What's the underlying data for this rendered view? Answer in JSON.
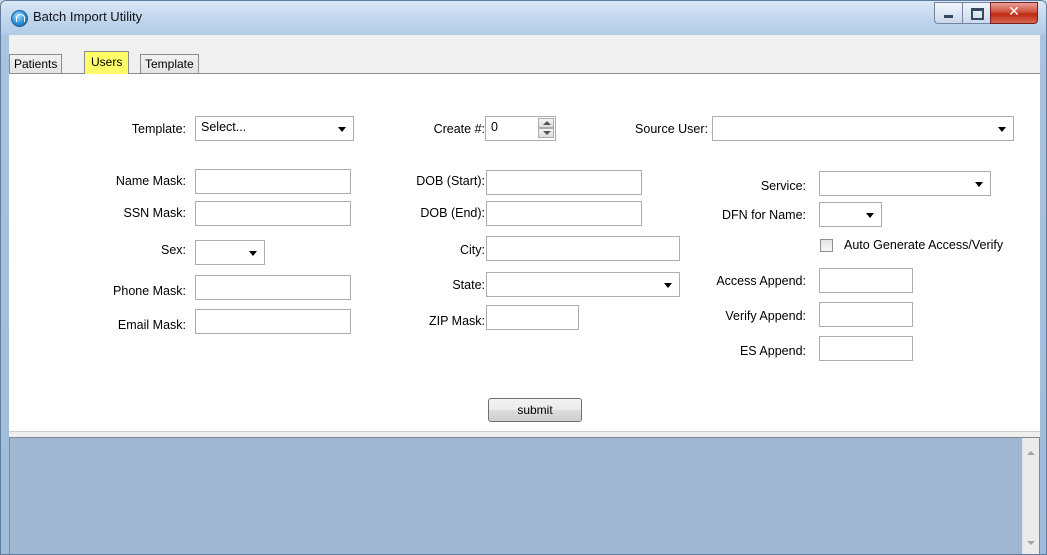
{
  "window": {
    "title": "Batch Import Utility",
    "buttons": {
      "minimize": "minimize",
      "maximize": "maximize",
      "close": "x"
    }
  },
  "tabs": [
    {
      "label": "Patients",
      "active": false
    },
    {
      "label": "Users",
      "active": true
    },
    {
      "label": "Template",
      "active": false
    }
  ],
  "colors": {
    "active_tab": "#ffff66",
    "output_panel": "#a0b7d2"
  },
  "form": {
    "template": {
      "label": "Template:",
      "value": "Select..."
    },
    "create_count": {
      "label": "Create #:",
      "value": "0"
    },
    "source_user": {
      "label": "Source User:",
      "value": ""
    },
    "name_mask": {
      "label": "Name Mask:",
      "value": ""
    },
    "ssn_mask": {
      "label": "SSN Mask:",
      "value": ""
    },
    "sex": {
      "label": "Sex:",
      "value": ""
    },
    "phone_mask": {
      "label": "Phone Mask:",
      "value": ""
    },
    "email_mask": {
      "label": "Email Mask:",
      "value": ""
    },
    "dob_start": {
      "label": "DOB (Start):",
      "value": ""
    },
    "dob_end": {
      "label": "DOB (End):",
      "value": ""
    },
    "city": {
      "label": "City:",
      "value": ""
    },
    "state": {
      "label": "State:",
      "value": ""
    },
    "zip_mask": {
      "label": "ZIP Mask:",
      "value": ""
    },
    "service": {
      "label": "Service:",
      "value": ""
    },
    "dfn_for_name": {
      "label": "DFN for Name:",
      "value": ""
    },
    "auto_generate": {
      "label": "Auto Generate Access/Verify",
      "checked": false
    },
    "access_append": {
      "label": "Access Append:",
      "value": ""
    },
    "verify_append": {
      "label": "Verify Append:",
      "value": ""
    },
    "es_append": {
      "label": "ES Append:",
      "value": ""
    },
    "submit_label": "submit"
  },
  "output": {
    "text": ""
  }
}
